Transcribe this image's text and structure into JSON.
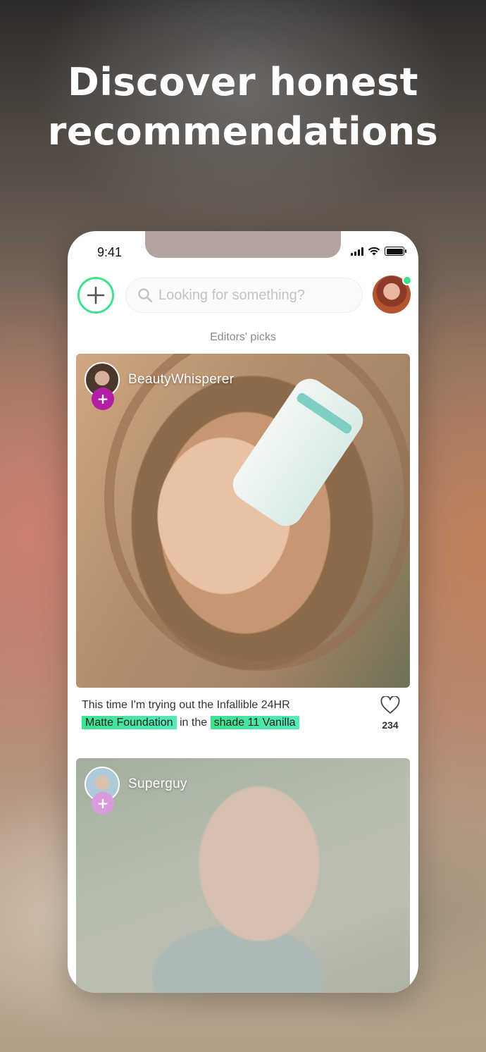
{
  "headline": {
    "line1": "Discover honest",
    "line2": "recommendations"
  },
  "status_bar": {
    "time": "9:41"
  },
  "top_bar": {
    "add_icon": "plus-icon",
    "search_placeholder": "Looking for something?",
    "search_icon": "search-icon",
    "avatar_status": "online"
  },
  "feed": {
    "section_label": "Editors' picks",
    "posts": [
      {
        "author": "BeautyWhisperer",
        "caption_prefix": "This time I'm trying out the Infallible 24HR",
        "tag_product": "Matte Foundation",
        "caption_middle": "in the",
        "tag_shade": "shade 11 Vanilla",
        "likes": "234"
      },
      {
        "author": "Superguy"
      }
    ]
  },
  "colors": {
    "accent_green": "#3de28d",
    "follow_badge": "#b21fa5"
  }
}
